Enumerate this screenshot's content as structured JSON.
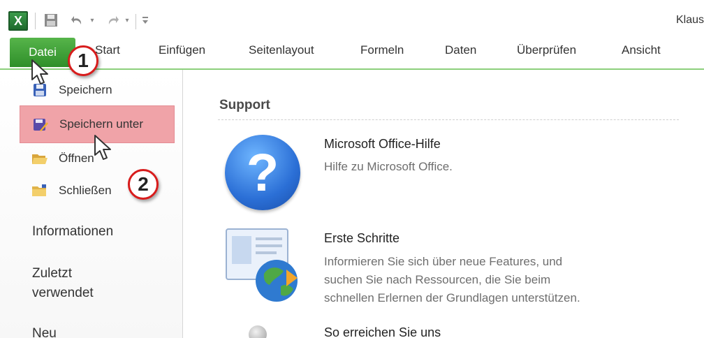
{
  "window": {
    "title": "Klaus"
  },
  "quick_access": {
    "app_icon": "excel-logo-icon",
    "app_icon_glyph": "X",
    "save_icon": "save-icon",
    "undo_icon": "undo-icon",
    "redo_icon": "redo-icon",
    "customize_icon": "customize-quick-access-icon"
  },
  "ribbon": {
    "tabs": [
      {
        "label": "Datei",
        "active": true
      },
      {
        "label": "Start"
      },
      {
        "label": "Einfügen"
      },
      {
        "label": "Seitenlayout"
      },
      {
        "label": "Formeln"
      },
      {
        "label": "Daten"
      },
      {
        "label": "Überprüfen"
      },
      {
        "label": "Ansicht"
      }
    ],
    "active_color": "#3f9e38"
  },
  "backstage": {
    "commands": [
      {
        "label": "Speichern",
        "icon": "save-icon"
      },
      {
        "label": "Speichern unter",
        "icon": "save-as-icon",
        "highlighted": true
      },
      {
        "label": "Öffnen",
        "icon": "open-folder-icon"
      },
      {
        "label": "Schließen",
        "icon": "close-folder-icon"
      }
    ],
    "pages": [
      {
        "label": "Informationen"
      },
      {
        "label": "Zuletzt verwendet",
        "lines": [
          "Zuletzt",
          "verwendet"
        ]
      },
      {
        "label": "Neu"
      }
    ],
    "highlight_color": "#f0a3a8"
  },
  "support": {
    "heading": "Support",
    "items": [
      {
        "title": "Microsoft Office-Hilfe",
        "desc_lines": [
          "Hilfe zu Microsoft Office."
        ],
        "icon": "help-question-icon"
      },
      {
        "title": "Erste Schritte",
        "desc_lines": [
          "Informieren Sie sich über neue Features, und",
          "suchen Sie nach Ressourcen, die Sie beim",
          "schnellen Erlernen der Grundlagen unterstützen."
        ],
        "icon": "getting-started-globe-icon"
      },
      {
        "title": "So erreichen Sie uns",
        "icon": "contact-icon"
      }
    ]
  },
  "annotations": {
    "step1": "1",
    "step2": "2",
    "marker_color": "#d81c1c"
  }
}
